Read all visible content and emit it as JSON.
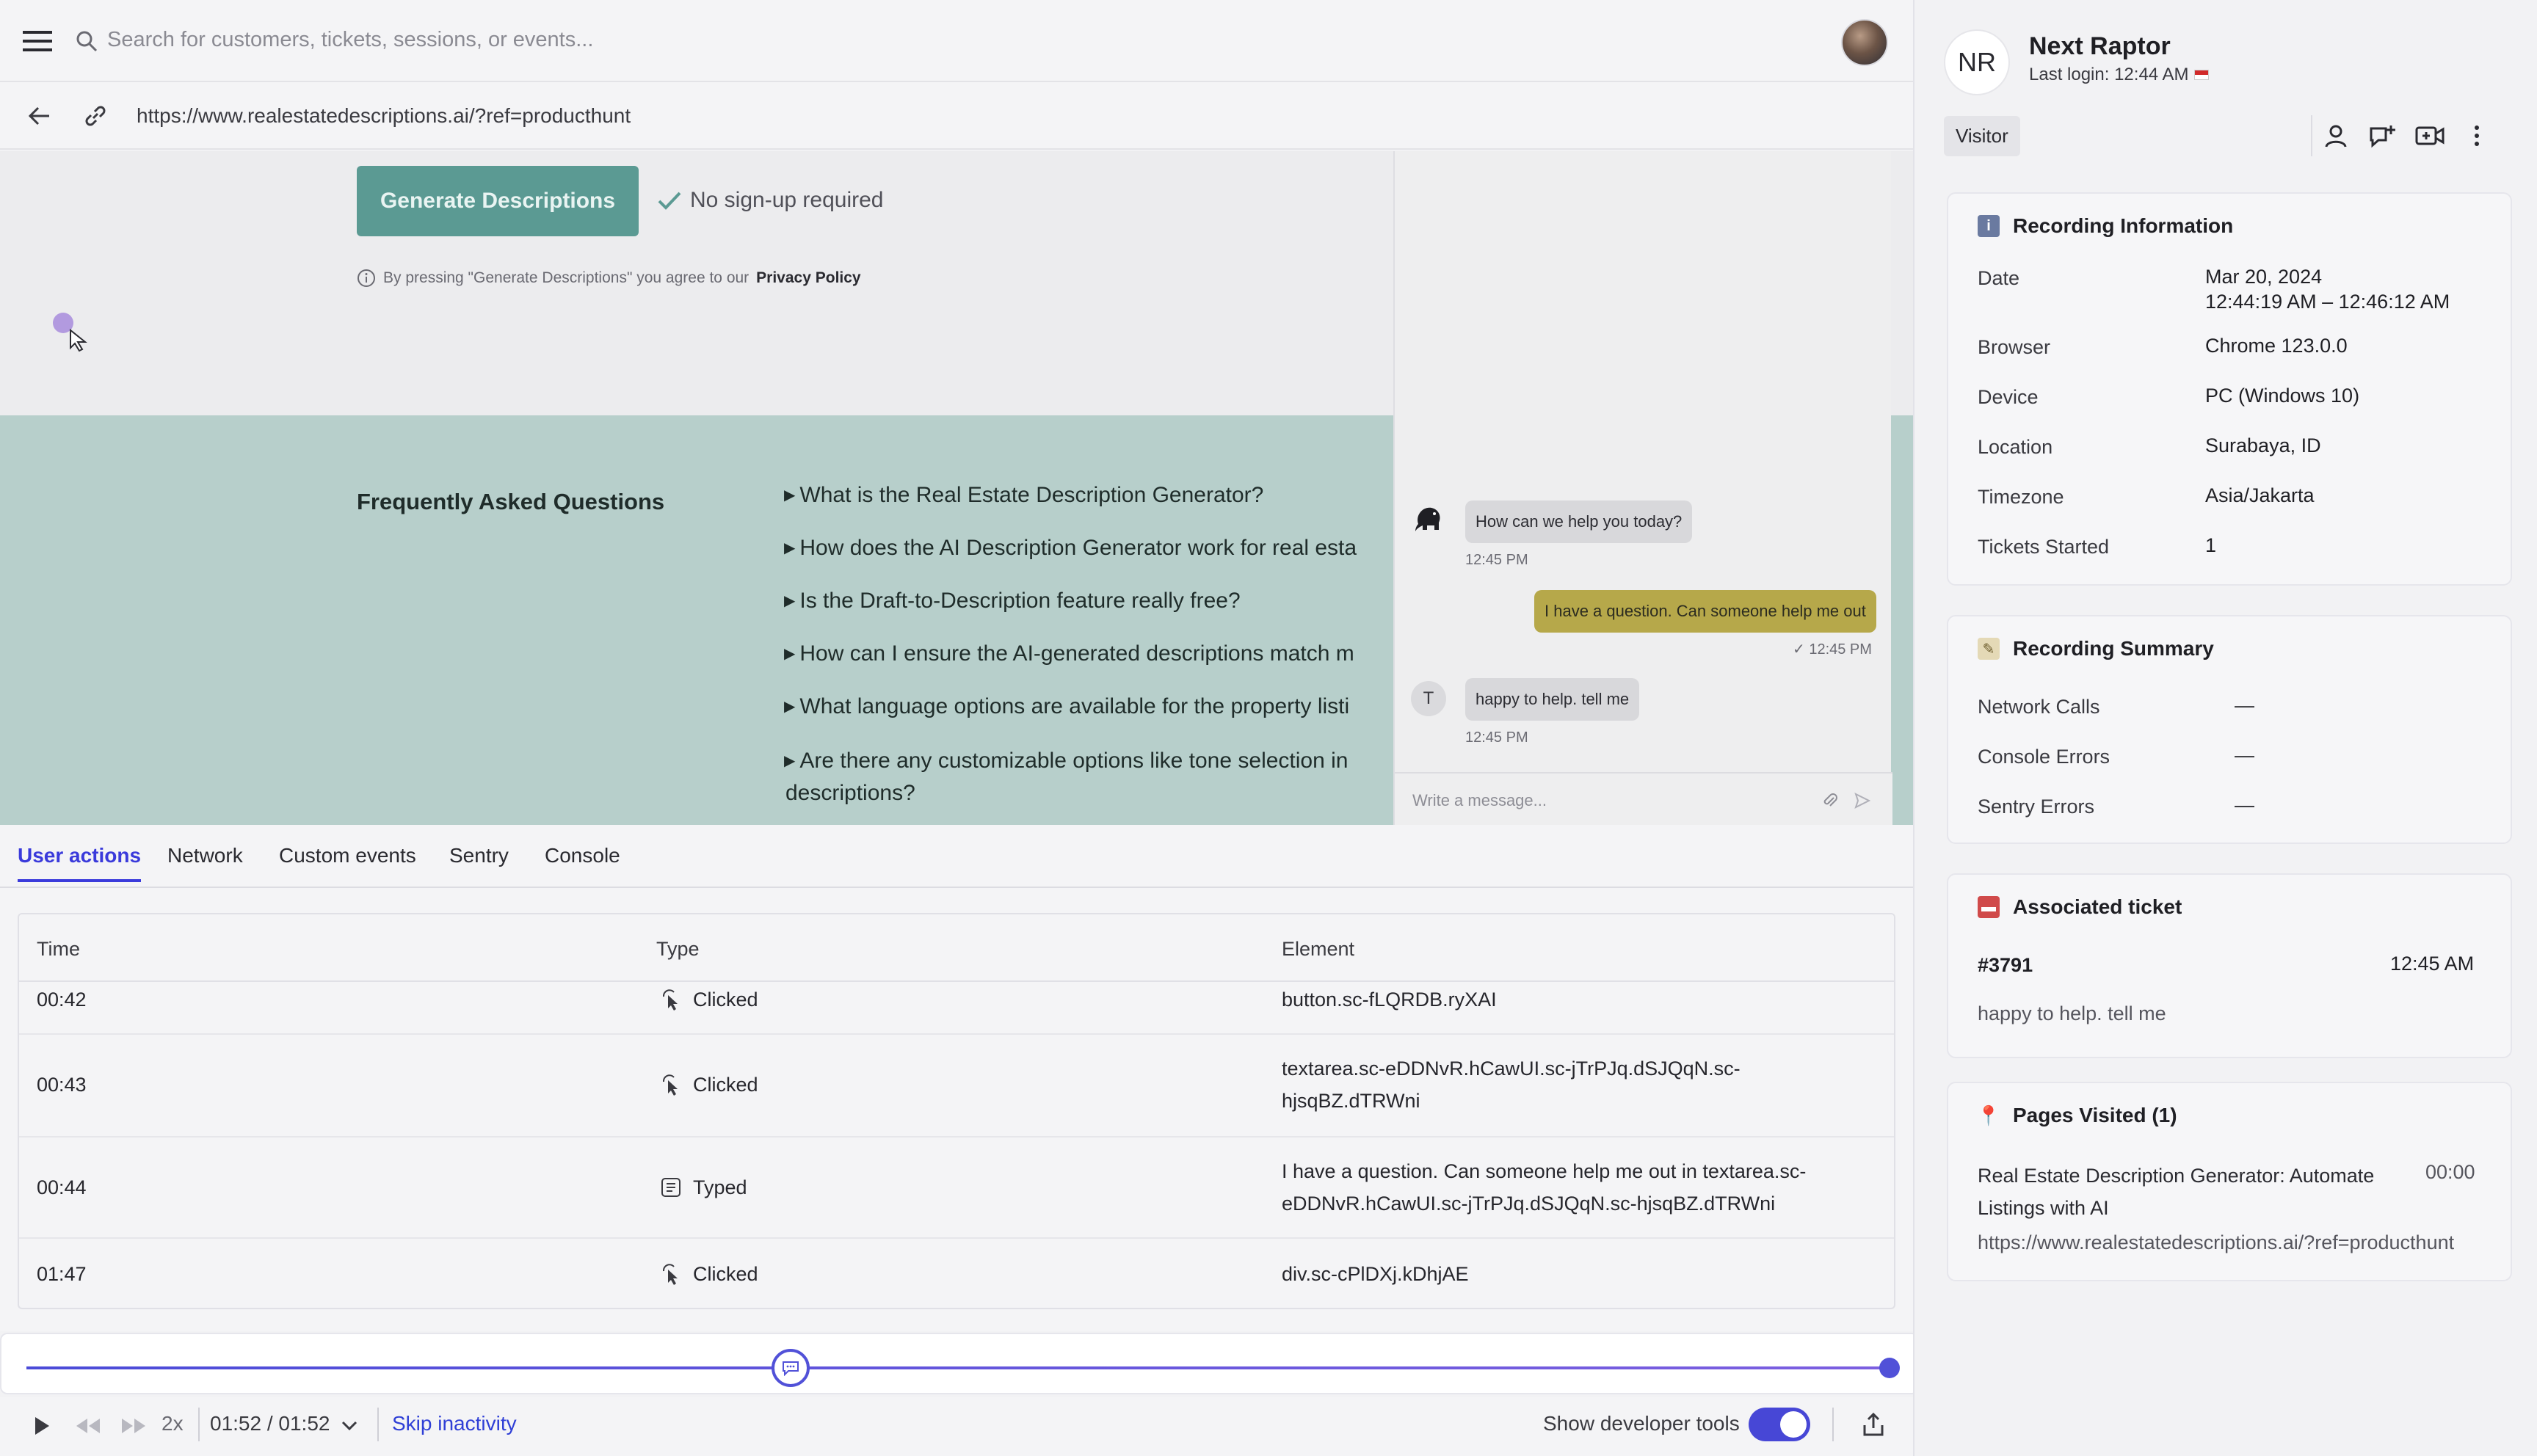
{
  "topbar": {
    "search_placeholder": "Search for customers, tickets, sessions, or events..."
  },
  "urlbar": {
    "url": "https://www.realestatedescriptions.ai/?ref=producthunt"
  },
  "webpage": {
    "cta_label": "Generate Descriptions",
    "no_signup": "No sign-up required",
    "privacy_prefix": "By pressing \"Generate Descriptions\" you agree to our",
    "privacy_link": "Privacy Policy",
    "faq_title": "Frequently Asked Questions",
    "faq_items": [
      "What is the Real Estate Description Generator?",
      "How does the AI Description Generator work for real esta",
      "Is the Draft-to-Description feature really free?",
      "How can I ensure the AI-generated descriptions match m",
      "What language options are available for the property listi",
      "Are there any customizable options like tone selection in",
      "descriptions?"
    ]
  },
  "chat": {
    "messages": [
      {
        "text": "How can we help you today?",
        "time": "12:45 PM"
      },
      {
        "text": "I have a question. Can someone help me out",
        "time": "12:45 PM"
      },
      {
        "text": "happy to help. tell me",
        "time": "12:45 PM"
      }
    ],
    "agent_initial": "T",
    "input_placeholder": "Write a message..."
  },
  "devtools": {
    "tabs": [
      "User actions",
      "Network",
      "Custom events",
      "Sentry",
      "Console"
    ],
    "columns": [
      "Time",
      "Type",
      "Element"
    ],
    "rows": [
      {
        "time": "00:42",
        "type": "Clicked",
        "element": "button.sc-fLQRDB.ryXAI"
      },
      {
        "time": "00:43",
        "type": "Clicked",
        "element": "textarea.sc-eDDNvR.hCawUI.sc-jTrPJq.dSJQqN.sc-\nhjsqBZ.dTRWni"
      },
      {
        "time": "00:44",
        "type": "Typed",
        "element": "I have a question. Can someone help me out in textarea.sc-\neDDNvR.hCawUI.sc-jTrPJq.dSJQqN.sc-hjsqBZ.dTRWni"
      },
      {
        "time": "01:47",
        "type": "Clicked",
        "element": "div.sc-cPlDXj.kDhjAE"
      }
    ]
  },
  "player": {
    "progress_fraction": 0.41,
    "speed": "2x",
    "time": "01:52 / 01:52",
    "skip_label": "Skip inactivity",
    "devtools_label": "Show developer tools",
    "devtools_enabled": true
  },
  "user": {
    "initials": "NR",
    "name": "Next Raptor",
    "last_login": "Last login: 12:44 AM",
    "badge": "Visitor"
  },
  "recording_info": {
    "title": "Recording Information",
    "fields": [
      {
        "label": "Date",
        "value": "Mar 20, 2024\n12:44:19 AM – 12:46:12 AM"
      },
      {
        "label": "Browser",
        "value": "Chrome 123.0.0"
      },
      {
        "label": "Device",
        "value": "PC (Windows 10)"
      },
      {
        "label": "Location",
        "value": "Surabaya, ID"
      },
      {
        "label": "Timezone",
        "value": "Asia/Jakarta"
      },
      {
        "label": "Tickets Started",
        "value": "1"
      }
    ]
  },
  "recording_summary": {
    "title": "Recording Summary",
    "fields": [
      {
        "label": "Network Calls",
        "value": "—"
      },
      {
        "label": "Console Errors",
        "value": "—"
      },
      {
        "label": "Sentry Errors",
        "value": "—"
      }
    ]
  },
  "ticket": {
    "title": "Associated ticket",
    "id": "#3791",
    "time": "12:45 AM",
    "preview": "happy to help. tell me"
  },
  "pages_visited": {
    "title": "Pages Visited (1)",
    "page_title": "Real Estate Description Generator: Automate Listings with AI",
    "duration": "00:00",
    "url": "https://www.realestatedescriptions.ai/?ref=producthunt"
  },
  "colors": {
    "accent": "#3a3adb",
    "cta": "#5b9a93",
    "faq_bg": "#b7cfcb",
    "chat_out": "#b6a84a"
  }
}
